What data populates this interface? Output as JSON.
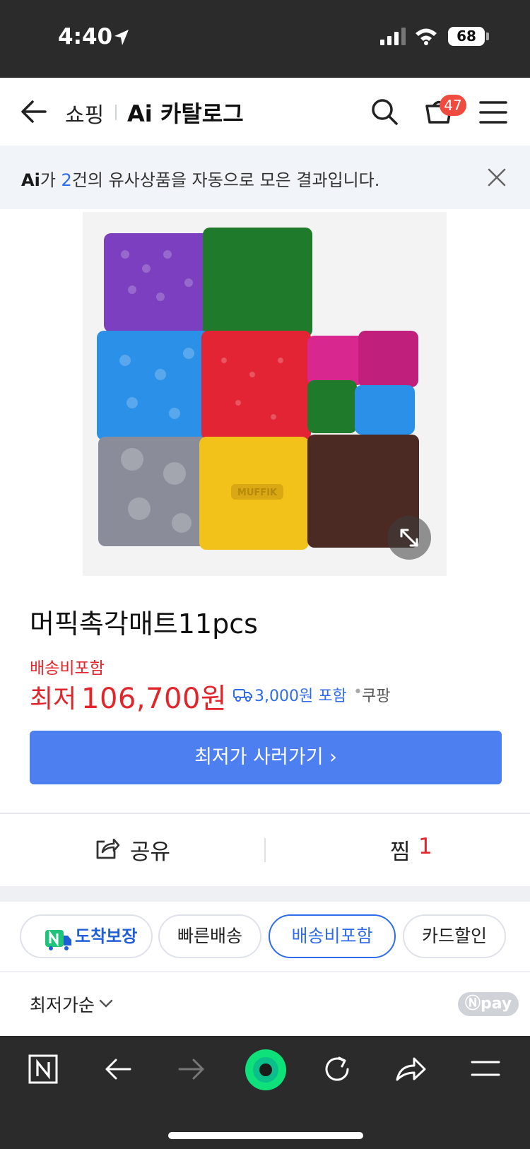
{
  "status_bar": {
    "time": "4:40",
    "battery": "68"
  },
  "header": {
    "section": "쇼핑",
    "title": "Ai 카탈로그",
    "cart_count": "47"
  },
  "ai_banner": {
    "logo": "Ai",
    "prefix": "가 ",
    "count": "2",
    "suffix": "건의 유사상품을 자동으로 모은 결과입니다."
  },
  "product": {
    "name": "머픽촉각매트11pcs",
    "shipping_included": "배송비포함",
    "price_label": "최저",
    "price": "106,700원",
    "shipping_fee": "3,000원 포함",
    "separator": "•",
    "store": "쿠팡",
    "image_watermark": "MUFFIK"
  },
  "buy_button": {
    "label": "최저가 사러가기 ›"
  },
  "actions": {
    "share_label": "공유",
    "save_label": "찜",
    "save_count": "1"
  },
  "filters": [
    {
      "label": "도착보장",
      "active": false
    },
    {
      "label": "빠른배송",
      "active": false
    },
    {
      "label": "배송비포함",
      "active": true
    },
    {
      "label": "카드할인",
      "active": false
    }
  ],
  "sort": {
    "label": "최저가순"
  },
  "npay": {
    "label": "pay"
  },
  "colors": {
    "accent": "#2f6bea",
    "button": "#4d7ff0",
    "price": "#e0262b",
    "badge": "#ef4b3e",
    "bar": "#2b2b2b"
  }
}
